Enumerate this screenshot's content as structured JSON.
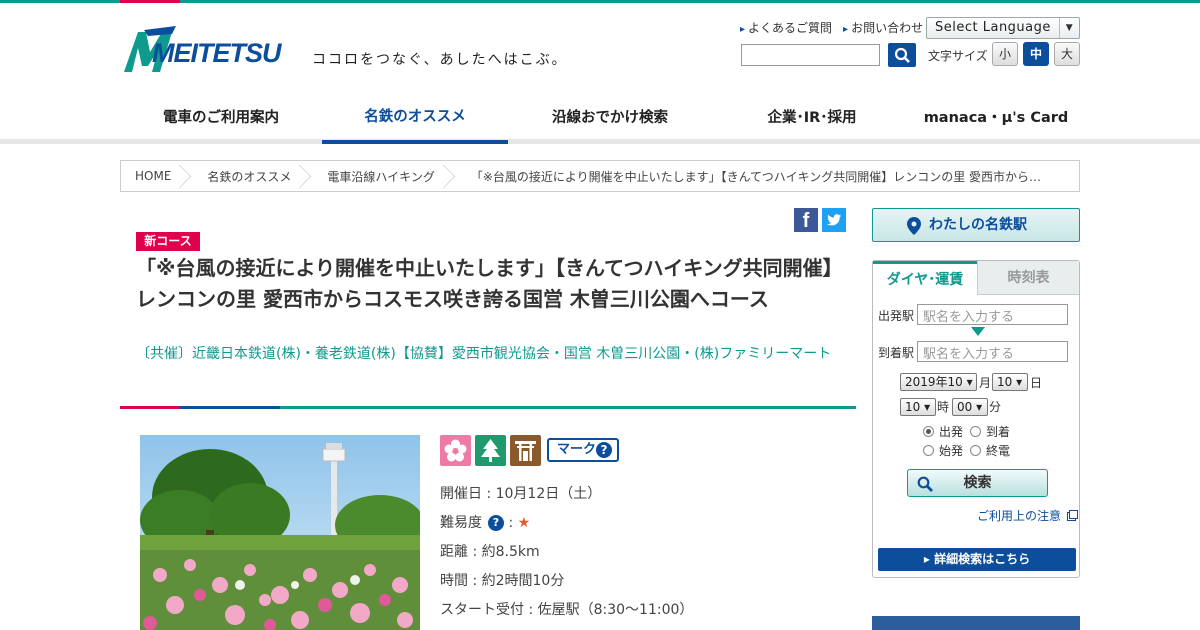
{
  "header": {
    "logo_text": "MEITETSU",
    "slogan": "ココロをつなぐ、あしたへはこぶ。",
    "links": [
      "よくあるご質問",
      "お問い合わせ"
    ],
    "language_label": "Select Language",
    "fontsize_label": "文字サイズ",
    "fontsizes": [
      "小",
      "中",
      "大"
    ]
  },
  "nav": {
    "items": [
      "電車のご利用案内",
      "名鉄のオススメ",
      "沿線おでかけ検索",
      "企業･IR･採用",
      "manaca・μ's Card"
    ],
    "active_index": 1
  },
  "breadcrumb": [
    "HOME",
    "名鉄のオススメ",
    "電車沿線ハイキング",
    "「※台風の接近により開催を中止いたします」【きんてつハイキング共同開催】レンコンの里 愛西市から…"
  ],
  "article": {
    "badge": "新コース",
    "title": "「※台風の接近により開催を中止いたします」【きんてつハイキング共同開催】レンコンの里 愛西市からコスモス咲き誇る国営 木曽三川公園へコース",
    "sponsor": "〔共催〕近畿日本鉄道(株)・養老鉄道(株)【協賛】愛西市観光協会・国営 木曽三川公園・(株)ファミリーマート",
    "mark_button": "マーク",
    "info": {
      "date": "開催日 : 10月12日（土）",
      "difficulty_label": "難易度",
      "difficulty_stars": "★",
      "distance": "距離 : 約8.5km",
      "time": "時間 : 約2時間10分",
      "start": "スタート受付 : 佐屋駅（8:30～11:00）"
    }
  },
  "sidebar": {
    "my_station": "わたしの名鉄駅",
    "tabs": [
      "ダイヤ･運賃",
      "時刻表"
    ],
    "from_label": "出発駅",
    "to_label": "到着駅",
    "station_placeholder": "駅名を入力する",
    "year_month": "2019年10",
    "month_unit": "月",
    "day": "10",
    "day_unit": "日",
    "hour": "10",
    "hour_unit": "時",
    "minute": "00",
    "minute_unit": "分",
    "radios": [
      "出発",
      "到着",
      "始発",
      "終電"
    ],
    "search_label": "検索",
    "caution": "ご利用上の注意",
    "detail": "詳細検索はこちら"
  },
  "colors": {
    "brand_blue": "#0c4d9c",
    "teal": "#0f9a8e",
    "red": "#e0004d"
  }
}
